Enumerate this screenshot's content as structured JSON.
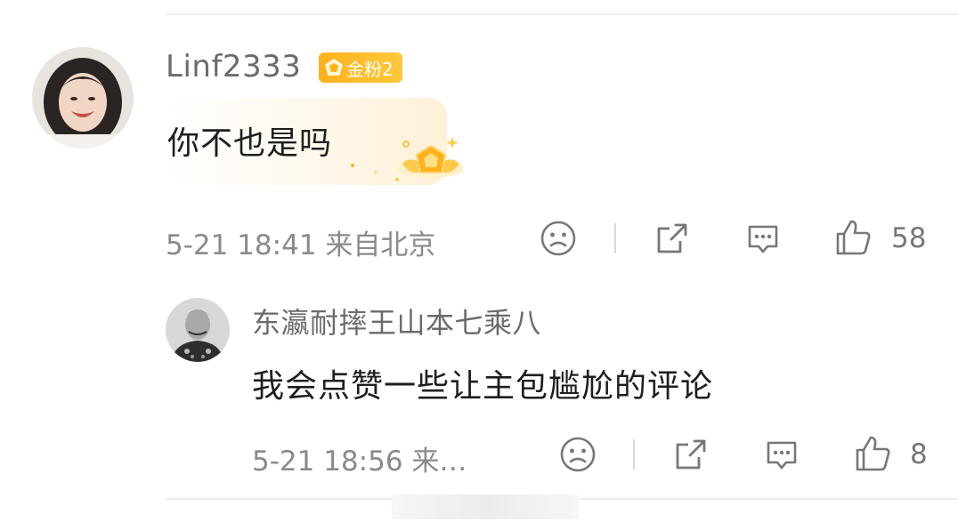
{
  "comments": [
    {
      "username": "Linf2333",
      "badge": "金粉2",
      "text": "你不也是吗",
      "meta": "5-21 18:41 来自北京",
      "likes": "58"
    }
  ],
  "reply": {
    "username": "东瀛耐摔王山本七乘八",
    "text": "我会点赞一些让主包尴尬的评论",
    "meta": "5-21 18:56 来…",
    "likes": "8"
  },
  "icons": {
    "face": "sad-face-icon",
    "share": "share-icon",
    "comment": "comment-icon",
    "like": "thumbs-up-icon",
    "badge": "gold-fan-badge-icon"
  },
  "colors": {
    "badge": "#ffb11b",
    "username": "#6b6b6b",
    "meta": "#8a8a8a",
    "divider": "#efefef"
  }
}
